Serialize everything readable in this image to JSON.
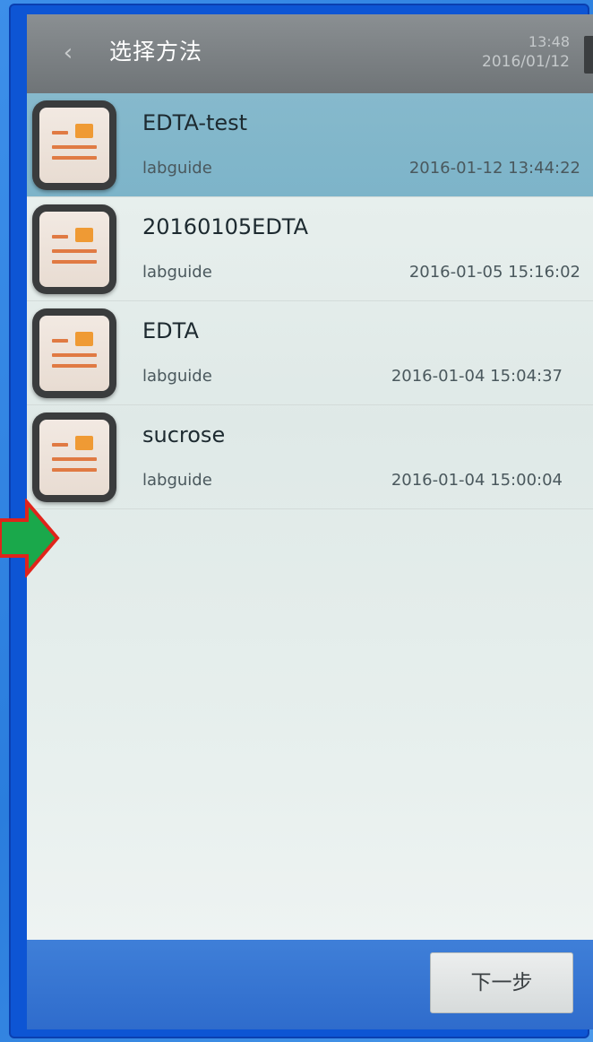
{
  "header": {
    "title": "选择方法",
    "time": "13:48",
    "date": "2016/01/12"
  },
  "methods": [
    {
      "name": "EDTA-test",
      "author": "labguide",
      "date": "2016-01-12 13:44:22"
    },
    {
      "name": "20160105EDTA",
      "author": "labguide",
      "date": "2016-01-05 15:16:02"
    },
    {
      "name": "EDTA",
      "author": "labguide",
      "date": "2016-01-04 15:04:37"
    },
    {
      "name": "sucrose",
      "author": "labguide",
      "date": "2016-01-04 15:00:04"
    }
  ],
  "footer": {
    "next_label": "下一步"
  },
  "icons": {
    "back": "chevron-left-icon",
    "document": "document-icon",
    "annotation": "arrow-right-icon"
  },
  "colors": {
    "header_bg": "#7a7f82",
    "selected_row": "#86b9cc",
    "footer_bg": "#3a78d4",
    "icon_accent": "#ef9a34",
    "arrow_fill": "#1aa84b",
    "arrow_stroke": "#e0241b"
  }
}
